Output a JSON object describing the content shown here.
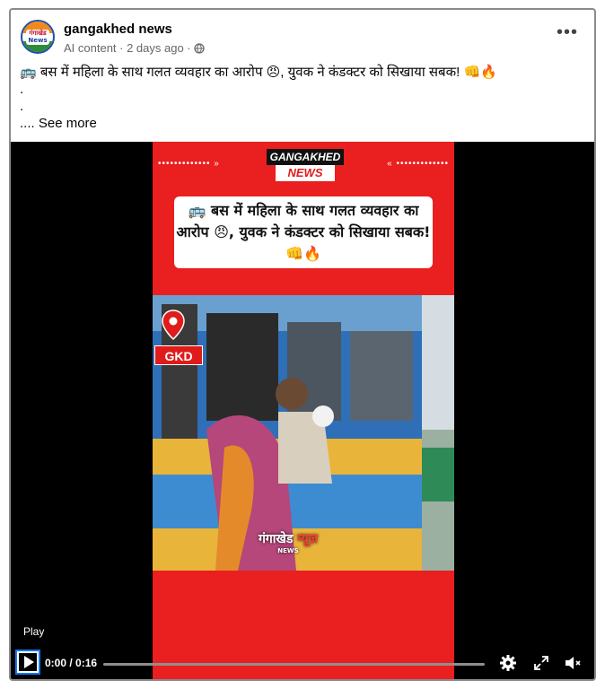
{
  "post": {
    "page_name": "gangakhed news",
    "meta": "AI content · 2 days ago ·",
    "avatar_text_1": "गंगाखेड",
    "avatar_text_2": "News",
    "caption_line": "🚌 बस में महिला के साथ गलत व्यवहार का आरोप 😠, युवक ने कंडक्टर को सिखाया सबक! 👊🔥",
    "dot_1": ".",
    "dot_2": ".",
    "see_more_prefix": "....",
    "see_more": "See more"
  },
  "reel": {
    "brand_top": "GANGAKHED",
    "brand_bottom": "NEWS",
    "dots": "•••••••••••••",
    "headline": "🚌 बस में महिला के साथ गलत व्यवहार का आरोप 😠, युवक ने कंडक्टर को सिखाया सबक! 👊🔥",
    "location_tag": "GKD",
    "watermark_prefix": "गंगाखेड ",
    "watermark_highlight": "न्यूज़",
    "watermark_sub": "NEWS"
  },
  "player": {
    "play_label": "Play",
    "time": "0:00 / 0:16",
    "progress": 0.0
  },
  "icons": [
    "more-icon",
    "globe-icon",
    "location-pin-icon",
    "play-icon",
    "settings-icon",
    "fullscreen-icon",
    "mute-icon"
  ],
  "colors": {
    "reel_red": "#ea1f1f",
    "link_blue": "#1877f2",
    "meta_gray": "#65676b"
  }
}
